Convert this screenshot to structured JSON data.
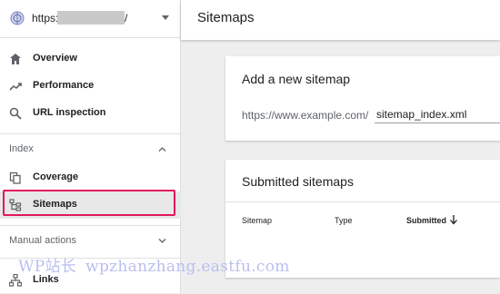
{
  "property": {
    "url_prefix": "https://",
    "url_suffix": "/",
    "icon": "globe-icon"
  },
  "sidebar": {
    "items_top": [
      {
        "label": "Overview",
        "icon": "home-icon"
      },
      {
        "label": "Performance",
        "icon": "trending-up-icon"
      },
      {
        "label": "URL inspection",
        "icon": "search-icon"
      }
    ],
    "index_section": {
      "title": "Index",
      "items": [
        {
          "label": "Coverage",
          "icon": "copy-icon"
        },
        {
          "label": "Sitemaps",
          "icon": "sitemap-icon",
          "active": true
        }
      ]
    },
    "manual_section": {
      "title": "Manual actions"
    },
    "links": {
      "label": "Links",
      "icon": "links-icon"
    }
  },
  "header": {
    "title": "Sitemaps"
  },
  "add_card": {
    "title": "Add a new sitemap",
    "prefix": "https://www.example.com/",
    "input_value": "sitemap_index.xml"
  },
  "submitted_card": {
    "title": "Submitted sitemaps",
    "columns": [
      "Sitemap",
      "Type",
      "Submitted"
    ]
  },
  "watermark": {
    "brand": "WP站长",
    "domain": "wpzhanzhang.eastfu.com"
  },
  "colors": {
    "highlight": "#e2175f",
    "accent_text": "#202124",
    "watermark": "#b9bff0"
  }
}
